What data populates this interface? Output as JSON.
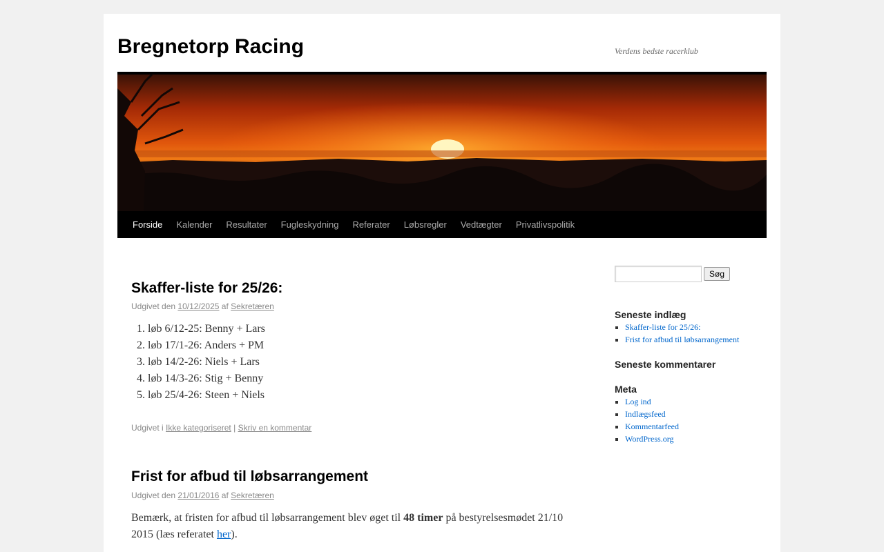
{
  "site": {
    "title": "Bregnetorp Racing",
    "description": "Verdens bedste racerklub"
  },
  "nav": {
    "items": [
      {
        "label": "Forside",
        "current": true
      },
      {
        "label": "Kalender"
      },
      {
        "label": "Resultater"
      },
      {
        "label": "Fugleskydning"
      },
      {
        "label": "Referater"
      },
      {
        "label": "Løbsregler"
      },
      {
        "label": "Vedtægter"
      },
      {
        "label": "Privatlivspolitik"
      }
    ]
  },
  "posts": [
    {
      "title": "Skaffer-liste for 25/26:",
      "meta_prefix": "Udgivet den",
      "date": "10/12/2025",
      "by": "af",
      "author": "Sekretæren",
      "list": [
        "løb 6/12-25: Benny + Lars",
        "løb 17/1-26: Anders + PM",
        "løb 14/2-26: Niels + Lars",
        "løb 14/3-26: Stig + Benny",
        "løb 25/4-26: Steen + Niels"
      ],
      "utility_prefix": "Udgivet i",
      "category": "Ikke kategoriseret",
      "separator": "|",
      "comment_link": "Skriv en kommentar"
    },
    {
      "title": "Frist for afbud til løbsarrangement",
      "meta_prefix": "Udgivet den",
      "date": "21/01/2016",
      "by": "af",
      "author": "Sekretæren",
      "body_before": "Bemærk, at fristen for afbud til løbsarrangement blev øget til ",
      "body_bold": "48 timer",
      "body_after": " på bestyrelsesmødet 21/10 2015 (læs referatet ",
      "body_link": "her",
      "body_end": ")."
    }
  ],
  "sidebar": {
    "search_button": "Søg",
    "search_value": "",
    "recent_posts": {
      "title": "Seneste indlæg",
      "items": [
        "Skaffer-liste for 25/26:",
        "Frist for afbud til løbsarrangement"
      ]
    },
    "recent_comments": {
      "title": "Seneste kommentarer"
    },
    "meta": {
      "title": "Meta",
      "items": [
        "Log ind",
        "Indlægsfeed",
        "Kommentarfeed",
        "WordPress.org"
      ]
    }
  },
  "colors": {
    "link": "#0066cc",
    "nav_bg": "#000000",
    "page_bg": "#f1f1f1"
  },
  "icons": {
    "header": "sunset-header-image"
  }
}
